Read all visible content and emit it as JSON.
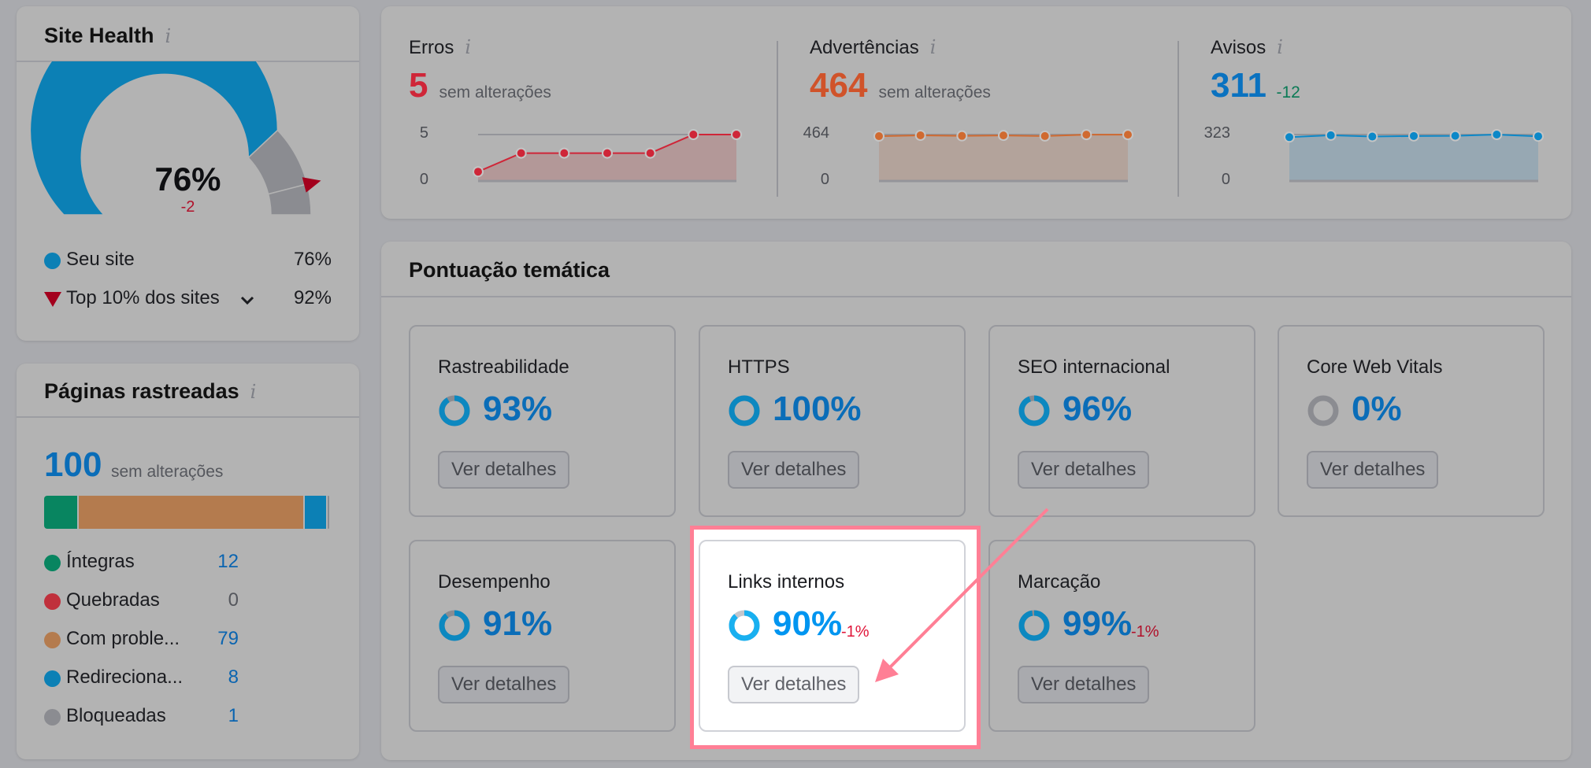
{
  "site_health": {
    "title": "Site Health",
    "info_icon": "i",
    "score": 76,
    "score_label": "76%",
    "delta": "-2",
    "top10_score": 92,
    "legend": [
      {
        "label": "Seu site",
        "value": "76%",
        "marker": "circle",
        "color": "#0c80b5"
      },
      {
        "label": "Top 10% dos sites",
        "value": "92%",
        "marker": "triangle-down",
        "color": "#a3001d",
        "has_dropdown": true
      }
    ],
    "colors": {
      "your_site": "#0c80b5",
      "remaining": "#8b8c91",
      "marker": "#a3001d",
      "delta": "#b0102a"
    }
  },
  "crawled_pages": {
    "title": "Páginas rastreadas",
    "info_icon": "i",
    "total": "100",
    "total_note": "sem alterações",
    "items": [
      {
        "label": "Íntegras",
        "value": 12,
        "color": "#088560",
        "value_color": "#0a64b0"
      },
      {
        "label": "Quebradas",
        "value": 0,
        "color": "#c0303c",
        "value_color": "#55575d"
      },
      {
        "label": "Com proble...",
        "value": 79,
        "color": "#b47b4e",
        "value_color": "#0a64b0"
      },
      {
        "label": "Redireciona...",
        "value": 8,
        "color": "#0c80b5",
        "value_color": "#0a64b0"
      },
      {
        "label": "Bloqueadas",
        "value": 1,
        "color": "#8b8c91",
        "value_color": "#0a64b0"
      }
    ]
  },
  "stats": [
    {
      "title": "Erros",
      "info_icon": "i",
      "value": "5",
      "note": "sem alterações",
      "value_color": "#cf2638",
      "note_color": "#55575d",
      "line_color": "#cf2638",
      "fill_color": "#b39898",
      "axis_max_label": "5",
      "axis_min_label": "0",
      "ymax": 5,
      "series": [
        1,
        3,
        3,
        3,
        3,
        5,
        5
      ]
    },
    {
      "title": "Advertências",
      "info_icon": "i",
      "value": "464",
      "note": "sem alterações",
      "value_color": "#d0532a",
      "note_color": "#55575d",
      "line_color": "#d06a30",
      "fill_color": "#b3a39b",
      "axis_max_label": "464",
      "axis_min_label": "0",
      "ymax": 464,
      "series": [
        448,
        456,
        451,
        455,
        449,
        463,
        463
      ]
    },
    {
      "title": "Avisos",
      "info_icon": "i",
      "value": "311",
      "note": "-12",
      "value_color": "#0a72c0",
      "note_color": "#0b7a55",
      "line_color": "#0c88c8",
      "fill_color": "#97a8b3",
      "axis_max_label": "323",
      "axis_min_label": "0",
      "ymax": 323,
      "series": [
        305,
        318,
        309,
        313,
        314,
        323,
        311
      ]
    }
  ],
  "thematic": {
    "title": "Pontuação temática",
    "button_label": "Ver detalhes",
    "cards": [
      {
        "title": "Rastreabilidade",
        "score": 93,
        "label": "93%",
        "delta": "",
        "active": false
      },
      {
        "title": "HTTPS",
        "score": 100,
        "label": "100%",
        "delta": "",
        "active": false
      },
      {
        "title": "SEO internacional",
        "score": 96,
        "label": "96%",
        "delta": "",
        "active": false
      },
      {
        "title": "Core Web Vitals",
        "score": 0,
        "label": "0%",
        "delta": "",
        "active": false
      },
      {
        "title": "Desempenho",
        "score": 91,
        "label": "91%",
        "delta": "",
        "active": false
      },
      {
        "title": "Links internos",
        "score": 90,
        "label": "90%",
        "delta": "-1%",
        "active": true
      },
      {
        "title": "Marcação",
        "score": 99,
        "label": "99%",
        "delta": "-1%",
        "active": false
      }
    ]
  },
  "annotation": {
    "highlight_color": "#ff7f95",
    "arrow_color": "#ff7f95"
  }
}
